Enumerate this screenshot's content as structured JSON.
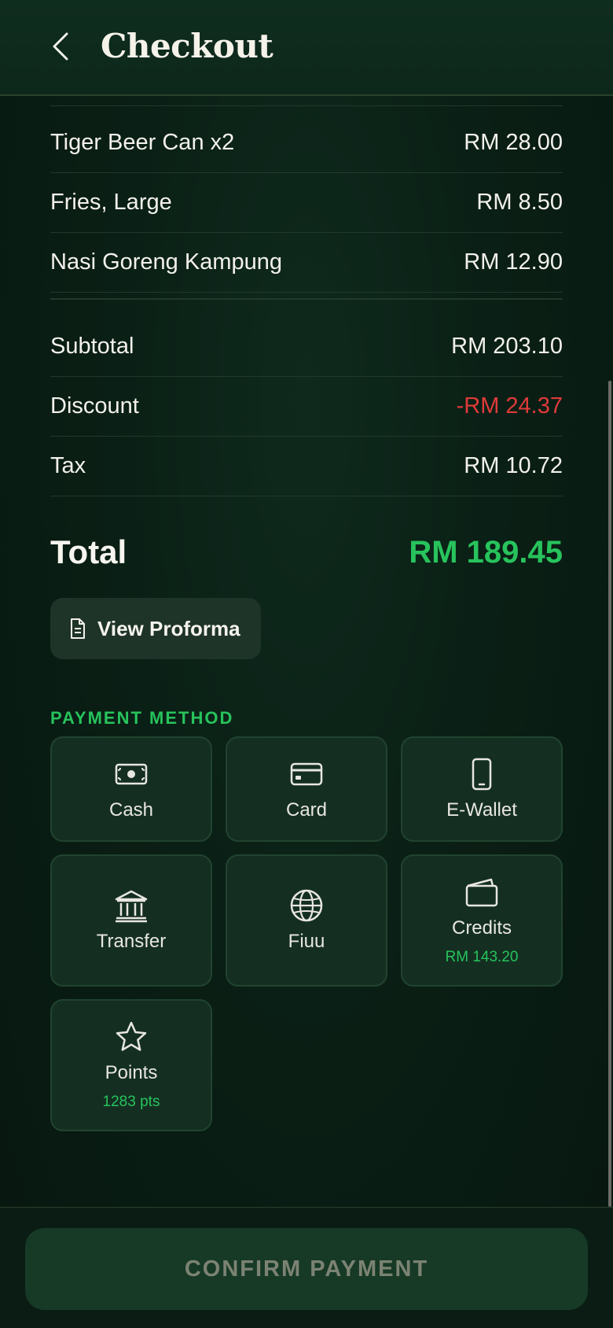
{
  "header": {
    "title": "Checkout"
  },
  "items": [
    {
      "name": "Tiger Beer Can x2",
      "price": "RM 28.00"
    },
    {
      "name": "Fries, Large",
      "price": "RM 8.50"
    },
    {
      "name": "Nasi Goreng Kampung",
      "price": "RM 12.90"
    }
  ],
  "summary": {
    "subtotal_label": "Subtotal",
    "subtotal_value": "RM 203.10",
    "discount_label": "Discount",
    "discount_value": "-RM 24.37",
    "tax_label": "Tax",
    "tax_value": "RM 10.72",
    "total_label": "Total",
    "total_value": "RM 189.45"
  },
  "proforma": {
    "label": "View Proforma"
  },
  "payment": {
    "heading": "PAYMENT METHOD",
    "methods": [
      {
        "name": "Cash",
        "icon": "cash-icon"
      },
      {
        "name": "Card",
        "icon": "card-icon"
      },
      {
        "name": "E-Wallet",
        "icon": "phone-icon"
      },
      {
        "name": "Transfer",
        "icon": "bank-icon"
      },
      {
        "name": "Fiuu",
        "icon": "globe-icon"
      },
      {
        "name": "Credits",
        "icon": "wallet-icon",
        "sub": "RM 143.20"
      },
      {
        "name": "Points",
        "icon": "star-icon",
        "sub": "1283 pts"
      }
    ]
  },
  "footer": {
    "confirm_label": "CONFIRM PAYMENT"
  },
  "colors": {
    "accent": "#27c35c",
    "discount": "#e03a3a",
    "background": "#0a1f15"
  }
}
